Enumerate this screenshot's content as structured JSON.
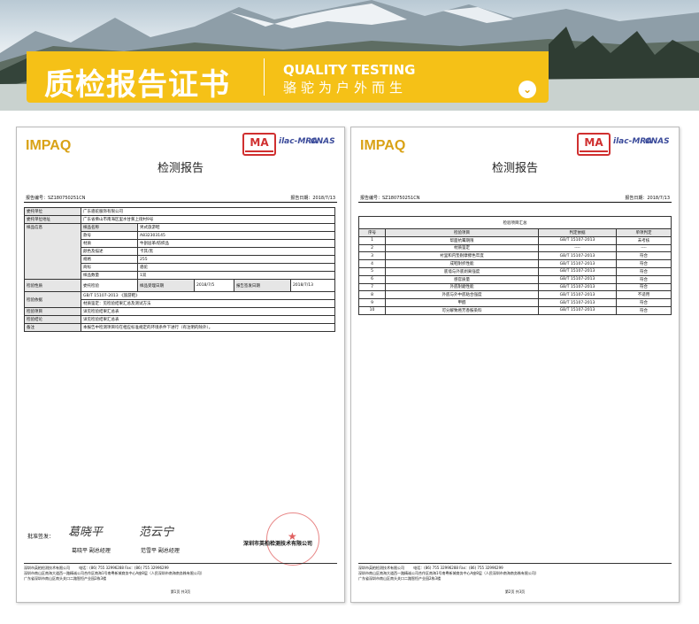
{
  "banner": {
    "title": "质检报告证书",
    "en": "QUALITY TESTING",
    "cn": "骆驼为户外而生",
    "btn": "⌄"
  },
  "report": {
    "logo": "IMPAQ",
    "ma": "MA",
    "cert1": "ilac-MRA",
    "cert2": "CNAS",
    "title": "检测报告",
    "no_label": "报告编号：SZ180750251CN",
    "date_label": "报告日期：2018/7/13",
    "sheet1": {
      "rows": [
        {
          "l": "委托单位",
          "v": "广东骆驼服饰有限公司"
        },
        {
          "l": "委托单位地址",
          "v": "广东省佛山市南海区里水甘蕉上街村9号"
        }
      ],
      "sample_label": "样品信息",
      "sample": [
        {
          "k": "样品名称",
          "v": "男式旅游鞋"
        },
        {
          "k": "款号",
          "v": "A832303145"
        },
        {
          "k": "材质",
          "v": "牛剖层革/纺织品"
        },
        {
          "k": "颜色及描述",
          "v": "卡其/黑"
        },
        {
          "k": "规格",
          "v": "255"
        },
        {
          "k": "商标",
          "v": "骆驼"
        },
        {
          "k": "样品数量",
          "v": "1双"
        }
      ],
      "nature_label": "检验性质",
      "nature": "委托检验",
      "recv_label": "样品受理日期",
      "recv": "2018/7/5",
      "issue_label": "报告签发日期",
      "issue": "2018/7/13",
      "basis_label": "检验依据",
      "basis1": "GB/T 15107-2013 《旅游鞋》",
      "basis2": "材质鉴定：见检验结果汇总及测试方法",
      "items_label": "检验项目",
      "items": "详见检验结果汇总表",
      "concl_label": "检验结论",
      "concl": "详见检验结果汇总表",
      "note_label": "备注",
      "note": "本报告中检测项目均在相应标准规定的环境条件下进行（有注明的除外）。",
      "approve": "批准签发：",
      "sign1": "葛晓平",
      "sign1b": "葛晓平 副总经理",
      "sign2": "范云宁",
      "sign2b": "范雪平 副总经理",
      "lab": "深圳市英柏检测技术有限公司",
      "page": "第1页 共3页"
    },
    "sheet2": {
      "summary": "检验项目汇总",
      "head": [
        "序号",
        "检验项目",
        "判定依据",
        "单项判定"
      ],
      "rows": [
        [
          "1",
          "帮面抗霉期限",
          "GB/T 15107-2013",
          "未考核"
        ],
        [
          "2",
          "材质鉴定",
          "----",
          "----"
        ],
        [
          "3",
          "衬里和内垫耐摩擦色牢度",
          "GB/T 15107-2013",
          "符合"
        ],
        [
          "4",
          "成鞋耐折性能",
          "GB/T 15107-2013",
          "符合"
        ],
        [
          "5",
          "底墙与外底剥离强度",
          "GB/T 15107-2013",
          "符合"
        ],
        [
          "6",
          "感官质量",
          "GB/T 15107-2013",
          "符合"
        ],
        [
          "7",
          "外底耐磨性能",
          "GB/T 15107-2013",
          "符合"
        ],
        [
          "8",
          "外底与外中底粘合强度",
          "GB/T 15107-2013",
          "不适用"
        ],
        [
          "9",
          "甲醛",
          "GB/T 15107-2013",
          "符合"
        ],
        [
          "10",
          "可分解致癌芳香胺染料",
          "GB/T 15107-2013",
          "符合"
        ]
      ],
      "page": "第2页 共3页"
    },
    "footer": {
      "l1": "深圳市英柏检测技术有限公司",
      "l1b": "电话：(86) 755 32996288 Fax：(86) 755 32996299",
      "l2": "深圳市南山区南海大道西一路精诚公司合作区南海1号南粤新城商务中心A座8层（人民深圳市南海南务株有限公司）",
      "l3": "广东省深圳市南山区南头关口二路智恒产业园2栋3楼"
    }
  },
  "colors": {
    "accent": "#f5c117",
    "logo": "#d9a216",
    "stamp": "#e06060"
  }
}
